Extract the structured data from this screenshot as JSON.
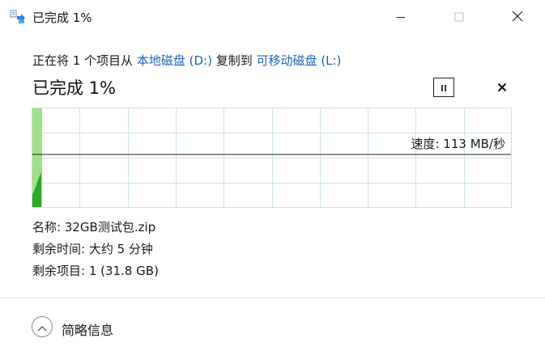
{
  "window": {
    "title": "已完成 1%",
    "app_icon": "file-copy-icon",
    "controls": [
      "minimize-icon",
      "maximize-icon",
      "close-icon"
    ]
  },
  "operation": {
    "prefix": "正在将 1 个项目从 ",
    "source": "本地磁盘 (D:)",
    "middle": " 复制到 ",
    "destination": "可移动磁盘 (L:)"
  },
  "progress": {
    "label": "已完成 1%",
    "percent": 1,
    "pause_icon": "pause-icon",
    "cancel_icon": "cancel-icon"
  },
  "graph": {
    "speed_label": "速度: 113 MB/秒",
    "completed_fraction": 0.01,
    "colors": {
      "fill": "#9fe08a",
      "fill_dark": "#2aa82a",
      "grid": "#cfe9cf",
      "border": "#cfe2cf",
      "line": "#222222"
    }
  },
  "details": {
    "name_label": "名称:",
    "name_value": "32GB测试包.zip",
    "time_label": "剩余时间:",
    "time_value": "大约 5 分钟",
    "items_label": "剩余项目:",
    "items_value": "1 (31.8 GB)"
  },
  "footer": {
    "toggle_label": "简略信息",
    "toggle_icon": "chevron-up-icon"
  },
  "colors": {
    "link": "#1a63b8"
  }
}
